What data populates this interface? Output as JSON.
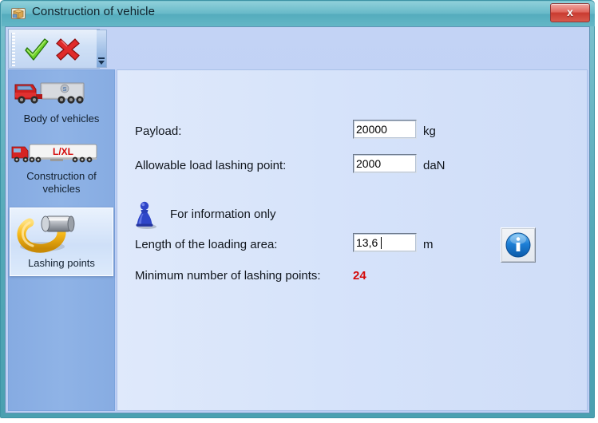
{
  "window": {
    "title": "Construction of vehicle",
    "icon": "package-box-icon",
    "close_label": "x"
  },
  "toolbar": {
    "ok_label": "ok-check",
    "cancel_label": "cancel-cross",
    "overflow_label": "more"
  },
  "sidebar": {
    "items": [
      {
        "label": "Body of vehicles",
        "icon": "truck-trailer-icon",
        "selected": false
      },
      {
        "label": "Construction of vehicles",
        "icon": "truck-lxl-icon",
        "selected": false
      },
      {
        "label": "Lashing points",
        "icon": "lashing-ring-icon",
        "selected": true
      }
    ]
  },
  "main": {
    "fields": [
      {
        "label": "Payload:",
        "value": "20000",
        "unit": "kg"
      },
      {
        "label": "Allowable load lashing point:",
        "value": "2000",
        "unit": "daN"
      }
    ],
    "info_note": {
      "text": "For information only",
      "icon": "blue-pawn-icon"
    },
    "length_field": {
      "label": "Length of the loading area:",
      "value": "13,6",
      "unit": "m"
    },
    "result": {
      "label": "Minimum number of lashing points:",
      "value": "24",
      "color": "#d40a0a"
    },
    "info_button": {
      "icon": "info-circle-icon"
    }
  },
  "lxl_badge": "L/XL"
}
